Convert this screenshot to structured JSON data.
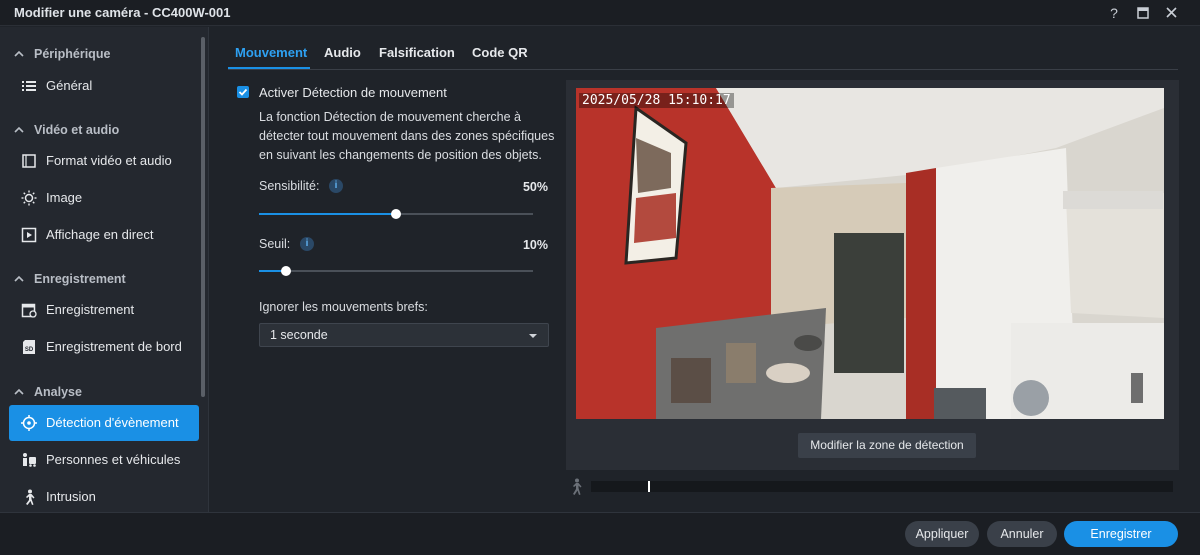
{
  "window": {
    "title": "Modifier une caméra - CC400W-001"
  },
  "sidebar": {
    "sections": [
      {
        "label": "Périphérique",
        "items": [
          {
            "label": "Général",
            "icon": "list-icon"
          }
        ]
      },
      {
        "label": "Vidéo et audio",
        "items": [
          {
            "label": "Format vidéo et audio",
            "icon": "film-icon"
          },
          {
            "label": "Image",
            "icon": "brightness-icon"
          },
          {
            "label": "Affichage en direct",
            "icon": "play-box-icon"
          }
        ]
      },
      {
        "label": "Enregistrement",
        "items": [
          {
            "label": "Enregistrement",
            "icon": "calendar-icon"
          },
          {
            "label": "Enregistrement de bord",
            "icon": "sd-card-icon"
          }
        ]
      },
      {
        "label": "Analyse",
        "items": [
          {
            "label": "Détection d'évènement",
            "icon": "target-icon",
            "active": true
          },
          {
            "label": "Personnes et véhicules",
            "icon": "person-vehicle-icon"
          },
          {
            "label": "Intrusion",
            "icon": "walking-person-icon"
          }
        ]
      }
    ]
  },
  "tabs": [
    {
      "label": "Mouvement",
      "active": true
    },
    {
      "label": "Audio"
    },
    {
      "label": "Falsification"
    },
    {
      "label": "Code QR"
    }
  ],
  "motion": {
    "enable_label": "Activer Détection de mouvement",
    "enabled": true,
    "description": "La fonction Détection de mouvement cherche à détecter tout mouvement dans des zones spécifiques en suivant les changements de position des objets.",
    "sensitivity": {
      "label": "Sensibilité:",
      "value_text": "50%",
      "value": 0.5
    },
    "threshold": {
      "label": "Seuil:",
      "value_text": "10%",
      "value": 0.1
    },
    "ignore_label": "Ignorer les mouvements brefs:",
    "ignore_value": "1 seconde"
  },
  "preview": {
    "timestamp": "2025/05/28 15:10:17",
    "edit_zone_label": "Modifier la zone de détection"
  },
  "footer": {
    "apply": "Appliquer",
    "cancel": "Annuler",
    "save": "Enregistrer"
  },
  "colors": {
    "accent": "#1a90e5",
    "background": "#1f2329",
    "sidebar": "#24282f"
  }
}
